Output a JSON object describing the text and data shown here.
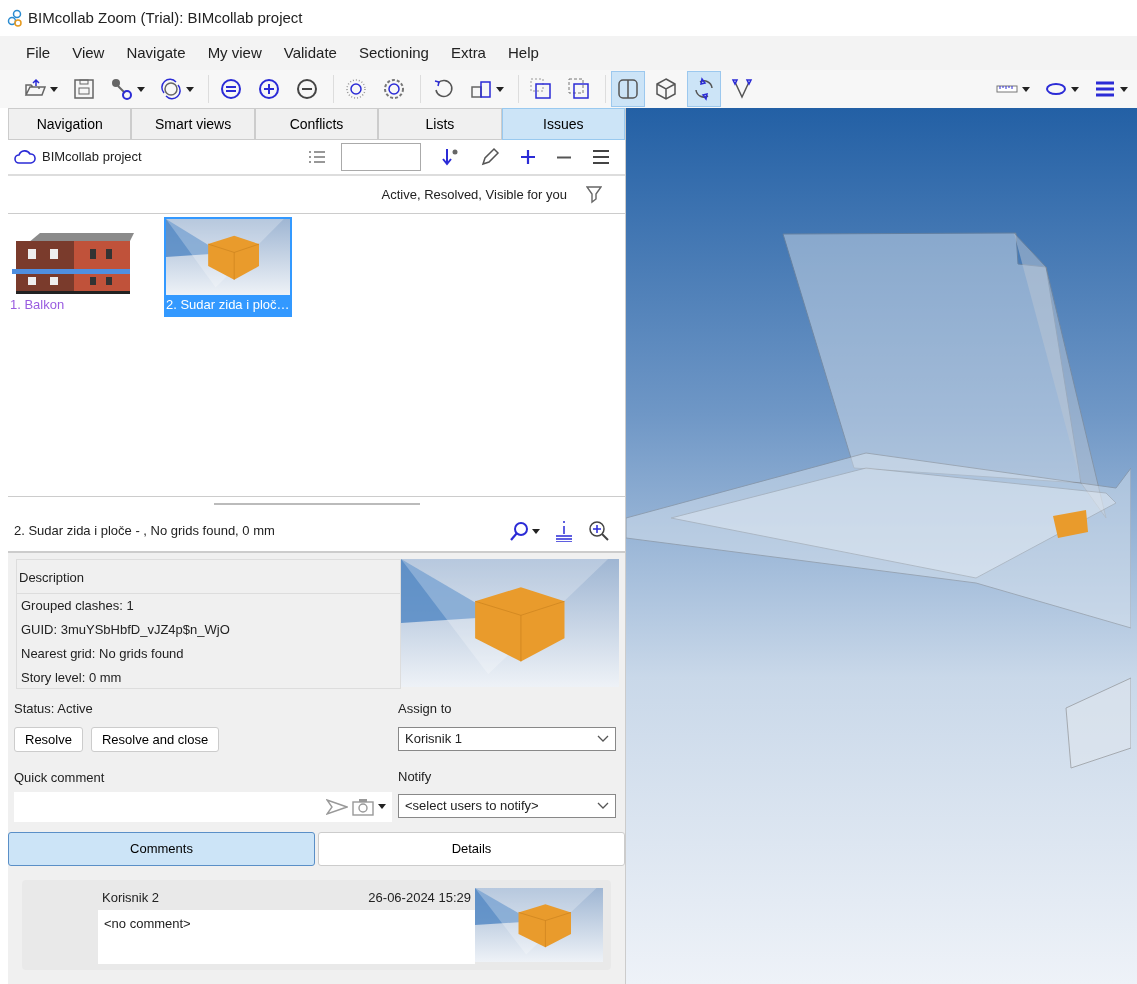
{
  "window": {
    "title": "BIMcollab Zoom (Trial): BIMcollab project"
  },
  "menu": [
    "File",
    "View",
    "Navigate",
    "My view",
    "Validate",
    "Sectioning",
    "Extra",
    "Help"
  ],
  "toolbar": {
    "left": [
      {
        "kind": "open",
        "dropdown": true,
        "selected": false
      },
      {
        "kind": "save",
        "dropdown": false,
        "selected": false
      },
      {
        "kind": "connect",
        "dropdown": true,
        "selected": false
      },
      {
        "kind": "sync",
        "dropdown": true,
        "selected": false
      },
      {
        "kind": "sep"
      },
      {
        "kind": "equal",
        "dropdown": false,
        "selected": false
      },
      {
        "kind": "plus",
        "dropdown": false,
        "selected": false
      },
      {
        "kind": "minus",
        "dropdown": false,
        "selected": false
      },
      {
        "kind": "sep"
      },
      {
        "kind": "dotcircle",
        "dropdown": false,
        "selected": false
      },
      {
        "kind": "dashcircle",
        "dropdown": false,
        "selected": false
      },
      {
        "kind": "sep"
      },
      {
        "kind": "undo",
        "dropdown": false,
        "selected": false
      },
      {
        "kind": "blocks",
        "dropdown": true,
        "selected": false
      },
      {
        "kind": "sep"
      },
      {
        "kind": "selbox",
        "dropdown": false,
        "selected": false
      },
      {
        "kind": "selbox2",
        "dropdown": false,
        "selected": false
      },
      {
        "kind": "sep"
      },
      {
        "kind": "section",
        "dropdown": false,
        "selected": true
      },
      {
        "kind": "cube",
        "dropdown": false,
        "selected": false
      },
      {
        "kind": "orbit",
        "dropdown": false,
        "selected": true
      },
      {
        "kind": "vertex",
        "dropdown": false,
        "selected": false
      }
    ],
    "right": [
      {
        "kind": "ruler",
        "dropdown": true,
        "selected": false
      },
      {
        "kind": "ellipse",
        "dropdown": true,
        "selected": false
      },
      {
        "kind": "lines",
        "dropdown": true,
        "selected": false
      }
    ]
  },
  "tabs": [
    {
      "label": "Navigation",
      "selected": false
    },
    {
      "label": "Smart views",
      "selected": false
    },
    {
      "label": "Conflicts",
      "selected": false
    },
    {
      "label": "Lists",
      "selected": false
    },
    {
      "label": "Issues",
      "selected": true
    }
  ],
  "project": {
    "name": "BIMcollab project"
  },
  "filter": {
    "label": "Active, Resolved, Visible for you"
  },
  "issues": [
    {
      "kind": "building",
      "label": "1. Balkon",
      "selected": false
    },
    {
      "kind": "clash",
      "label": "2. Sudar zida i ploč…",
      "selected": true
    }
  ],
  "issue": {
    "title": "2. Sudar zida i ploče - , No grids found, 0 mm",
    "description_label": "Description",
    "description": [
      "Grouped clashes: 1",
      "GUID: 3muYSbHbfD_vJZ4p$n_WjO",
      "Nearest grid: No grids found",
      "Story level: 0 mm"
    ],
    "status": "Status: Active",
    "buttons": [
      "Resolve",
      "Resolve and close"
    ],
    "assign_label": "Assign to",
    "assign_value": "Korisnik 1",
    "quick_comment_label": "Quick comment",
    "notify_label": "Notify",
    "notify_value": "<select users to notify>"
  },
  "subtabs": [
    {
      "label": "Comments",
      "selected": true
    },
    {
      "label": "Details",
      "selected": false
    }
  ],
  "comments": [
    {
      "author": "Korisnik 2",
      "date": "26-06-2024 15:29",
      "text": "<no comment>"
    }
  ]
}
